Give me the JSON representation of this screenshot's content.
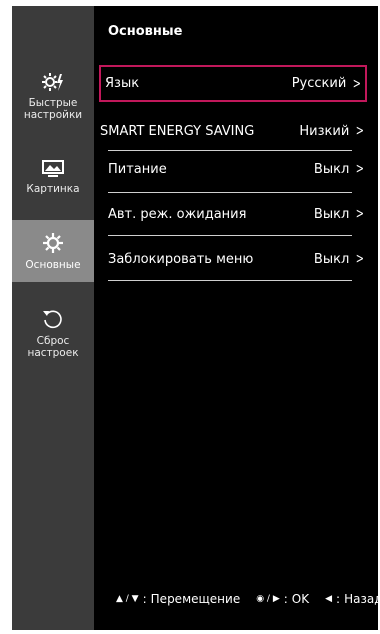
{
  "sidebar": {
    "items": [
      {
        "label_line1": "Быстрые",
        "label_line2": "настройки",
        "icon": "quick-settings-icon",
        "active": false
      },
      {
        "label_line1": "Картинка",
        "label_line2": "",
        "icon": "picture-icon",
        "active": false
      },
      {
        "label_line1": "Основные",
        "label_line2": "",
        "icon": "gear-icon",
        "active": true
      },
      {
        "label_line1": "Сброс",
        "label_line2": "настроек",
        "icon": "reset-icon",
        "active": false
      }
    ]
  },
  "main": {
    "title": "Основные",
    "rows": [
      {
        "label": "Язык",
        "value": "Русский",
        "selected": true
      },
      {
        "label": "SMART ENERGY SAVING",
        "value": "Низкий",
        "selected": false
      },
      {
        "label": "Питание",
        "value": "Выкл",
        "selected": false
      },
      {
        "label": "Авт. реж. ожидания",
        "value": "Выкл",
        "selected": false
      },
      {
        "label": "Заблокировать меню",
        "value": "Выкл",
        "selected": false
      }
    ],
    "chevron": ">"
  },
  "footer": {
    "move_symbols": "▲ / ▼",
    "move_label": "Перемещение",
    "ok_symbols": "◉ / ▶",
    "ok_label": "OK",
    "back_symbol": "◀",
    "back_label": "Назад",
    "colon": ":"
  },
  "colors": {
    "sidebar_bg": "#3b3b3b",
    "active_bg": "#8a8a8a",
    "selection_border": "#c2185b",
    "panel_bg": "#000000"
  }
}
